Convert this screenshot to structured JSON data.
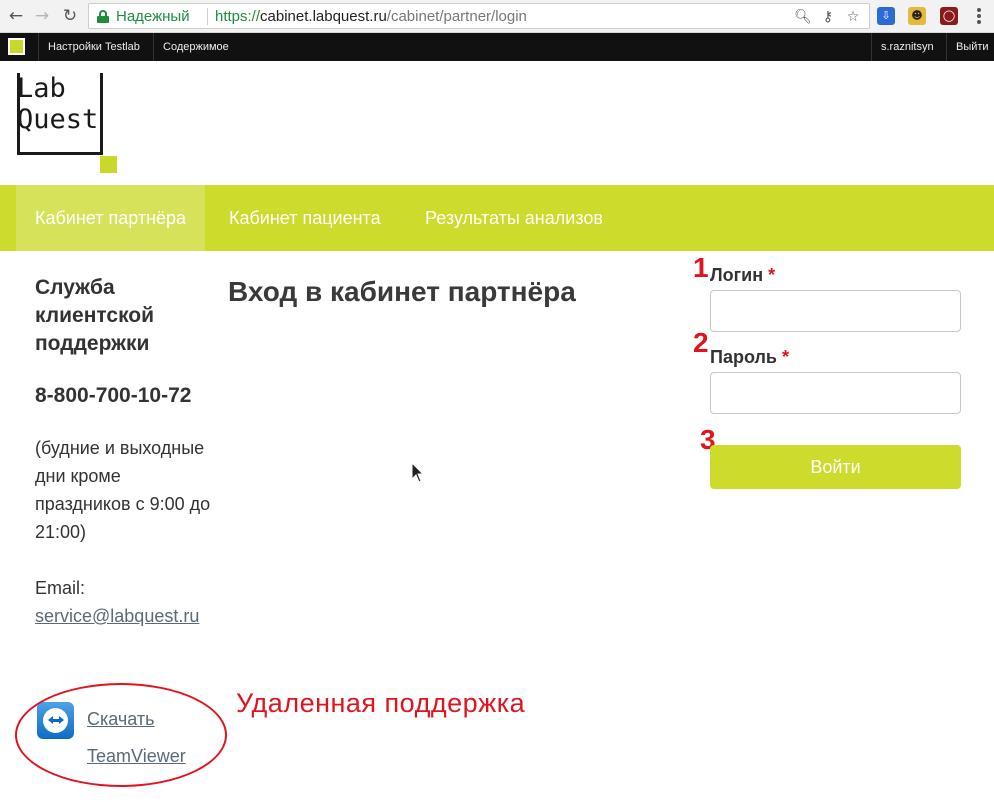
{
  "browser": {
    "secure_label": "Надежный",
    "url_scheme": "https://",
    "url_host": "cabinet.labquest.ru",
    "url_path": "/cabinet/partner/login",
    "icons": [
      "back-icon",
      "forward-icon",
      "reload-icon",
      "lock-icon",
      "zoom-icon",
      "key-icon",
      "star-icon",
      "extension-icons",
      "menu-icon"
    ]
  },
  "admin_bar": {
    "items": [
      "Настройки Testlab",
      "Содержимое"
    ],
    "user": "s.raznitsyn",
    "logout": "Выйти"
  },
  "logo": {
    "line1": "Lab",
    "line2": "Quest"
  },
  "nav": {
    "tabs": [
      {
        "label": "Кабинет партнёра",
        "active": true
      },
      {
        "label": "Кабинет пациента",
        "active": false
      },
      {
        "label": "Результаты анализов",
        "active": false
      }
    ]
  },
  "sidebar": {
    "support_title": "Служба клиентской поддержки",
    "phone": "8-800-700-10-72",
    "hours": "(будние и выходные дни кроме праздников с 9:00 до 21:00)",
    "email_label": "Email:",
    "email": "service@labquest.ru",
    "teamviewer_download": "Скачать",
    "teamviewer_name": "TeamViewer"
  },
  "annotation": {
    "remote_support": "Удаленная поддержка",
    "step1": "1",
    "step2": "2",
    "step3": "3"
  },
  "main": {
    "title": "Вход в кабинет партнёра"
  },
  "form": {
    "login_label": "Логин",
    "password_label": "Пароль",
    "required_mark": "*",
    "login_value": "",
    "password_value": "",
    "submit_label": "Войти"
  },
  "colors": {
    "brand_green": "#cddb2c",
    "annotation_red": "#e0141e"
  }
}
